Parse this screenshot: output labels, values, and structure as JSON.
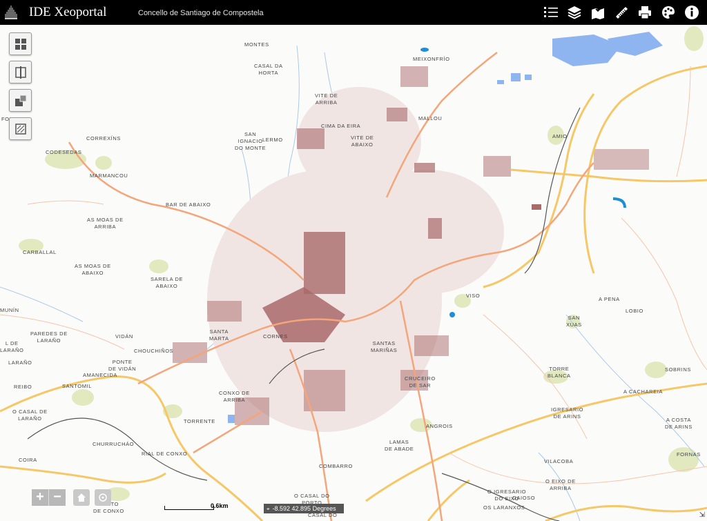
{
  "header": {
    "title": "IDE Xeoportal",
    "subtitle": "Concello de Santiago de Compostela",
    "tools": [
      {
        "name": "legend-icon"
      },
      {
        "name": "layers-icon"
      },
      {
        "name": "map-query-icon"
      },
      {
        "name": "measure-ruler-icon"
      },
      {
        "name": "print-icon"
      },
      {
        "name": "palette-icon"
      },
      {
        "name": "info-icon"
      }
    ]
  },
  "map": {
    "colors": {
      "background": "#fbfbfa",
      "major_road": "#f4a57a",
      "motorway": "#f6c766",
      "buildings": "#a96a6a",
      "water": "#a9c9e8",
      "green": "#dfe7b8",
      "industrial": "#8fb5f0",
      "rail": "#555555"
    },
    "places": [
      {
        "id": "montes",
        "text": "MONTES"
      },
      {
        "id": "casal-da-horta",
        "text": "CASAL DA\nHORTA"
      },
      {
        "id": "meixonfrio",
        "text": "MEIXONFRÍO"
      },
      {
        "id": "vite-de-arriba",
        "text": "VITE DE\nARRIBA"
      },
      {
        "id": "mallou",
        "text": "MALLOU"
      },
      {
        "id": "cima-da-eira",
        "text": "CIMA DA EIRA"
      },
      {
        "id": "folgoso",
        "text": "FOLGOSO"
      },
      {
        "id": "correxins",
        "text": "CORREXÍNS"
      },
      {
        "id": "codesedas",
        "text": "CODESEDAS"
      },
      {
        "id": "san-ignacio-do-monte",
        "text": "SAN\nIGNACIO\nDO MONTE"
      },
      {
        "id": "lermo",
        "text": "LERMO"
      },
      {
        "id": "vite-de-abaixo",
        "text": "VITE DE\nABAIXO"
      },
      {
        "id": "amio",
        "text": "AMIO"
      },
      {
        "id": "marmancou",
        "text": "MARMANCOU"
      },
      {
        "id": "bar-de-abaixo",
        "text": "BAR DE ABAIXO"
      },
      {
        "id": "as-moas-de-arriba",
        "text": "AS MOAS DE\nARRIBA"
      },
      {
        "id": "carballal",
        "text": "CARBALLAL"
      },
      {
        "id": "as-moas-de-abaixo",
        "text": "AS MOAS DE\nABAIXO"
      },
      {
        "id": "sarela-de-abaixo",
        "text": "SARELA DE\nABAIXO"
      },
      {
        "id": "viso",
        "text": "VISO"
      },
      {
        "id": "a-pena",
        "text": "A PENA"
      },
      {
        "id": "lobio",
        "text": "LOBIO"
      },
      {
        "id": "san-xuas",
        "text": "SAN\nXUAS"
      },
      {
        "id": "munin",
        "text": "MUNÍN"
      },
      {
        "id": "paredes-de-larano",
        "text": "PAREDES DE\nLARAÑO"
      },
      {
        "id": "vidan",
        "text": "VIDÁN"
      },
      {
        "id": "santa-marta",
        "text": "SANTA\nMARTA"
      },
      {
        "id": "cornes",
        "text": "CORNES"
      },
      {
        "id": "santas-marinas",
        "text": "SANTAS\nMARIÑAS"
      },
      {
        "id": "l-de-larano",
        "text": "L DE\nLARAÑO"
      },
      {
        "id": "chouchinos",
        "text": "CHOUCHIÑOS"
      },
      {
        "id": "ponte-de-vidan",
        "text": "PONTE\nDE VIDÁN"
      },
      {
        "id": "amanecida",
        "text": "AMANECIDA"
      },
      {
        "id": "larano",
        "text": "LARAÑO"
      },
      {
        "id": "torre-blanca",
        "text": "TORRE\nBLANCA"
      },
      {
        "id": "sobrins",
        "text": "SOBRINS"
      },
      {
        "id": "reibo",
        "text": "REIBO"
      },
      {
        "id": "santomil",
        "text": "SANTOMIL"
      },
      {
        "id": "conxo-de-arriba",
        "text": "CONXO DE\nARRIBA"
      },
      {
        "id": "cruceiro-de-sar",
        "text": "CRUCEIRO\nDE SAR"
      },
      {
        "id": "a-cachareia",
        "text": "A CACHAREIA"
      },
      {
        "id": "o-casal-de-larano",
        "text": "O CASAL DE\nLARAÑO"
      },
      {
        "id": "torrente",
        "text": "TORRENTE"
      },
      {
        "id": "igresario-de-arins",
        "text": "IGRESARIO\nDE ARINS"
      },
      {
        "id": "a-costa-de-arins",
        "text": "A COSTA\nDE ARINS"
      },
      {
        "id": "angrois",
        "text": "ANGROIS"
      },
      {
        "id": "churrucheo",
        "text": "CHURRUCHÁO"
      },
      {
        "id": "lamas-de-abade",
        "text": "LAMAS\nDE ABADE"
      },
      {
        "id": "rial-de-conxo",
        "text": "RIAL DE CONXO"
      },
      {
        "id": "coira",
        "text": "COIRA"
      },
      {
        "id": "vilacoba",
        "text": "VILACOBA"
      },
      {
        "id": "fornas",
        "text": "FORNAS"
      },
      {
        "id": "combarro",
        "text": "COMBARRO"
      },
      {
        "id": "o-eixo-de-arriba",
        "text": "O EIXO DE\nARRIBA"
      },
      {
        "id": "o-casal-do-porto",
        "text": "O CASAL DO\nPORTO"
      },
      {
        "id": "o-igresario-do-eixo",
        "text": "O IGRESARIO\nDO EIXO"
      },
      {
        "id": "gaioso",
        "text": "GAIOSO"
      },
      {
        "id": "os-laranxos",
        "text": "OS LARANXOS"
      },
      {
        "id": "porto-de-conxo",
        "text": "PORTO\nDE CONXO"
      },
      {
        "id": "casal-do",
        "text": "CASAL DO"
      }
    ]
  },
  "widgets": {
    "left": [
      {
        "name": "basemap-gallery-icon"
      },
      {
        "name": "swipe-compare-icon"
      },
      {
        "name": "overview-map-icon"
      },
      {
        "name": "draw-tool-icon"
      }
    ]
  },
  "controls": {
    "zoom_in": "+",
    "zoom_out": "−",
    "scale_label": "0.6km",
    "coords_text": "-8.592 42.895 Degrees"
  }
}
